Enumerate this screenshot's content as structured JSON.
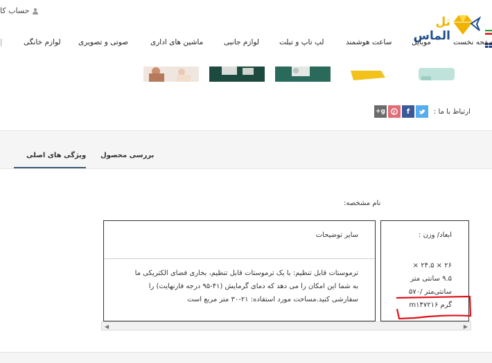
{
  "header": {
    "account_label": "حساب کا",
    "logo": {
      "text_main": "الماس",
      "text_accent": "تل"
    },
    "nav": [
      "صفحه نخست",
      "موبایل",
      "ساعت هوشمند",
      "لپ تاپ و تبلت",
      "لوازم جانبی",
      "ماشین های اداری",
      "صوتی و تصویری",
      "لوازم خانگی"
    ]
  },
  "share": {
    "label": "ارتباط با ما :",
    "icons": [
      "twitter-icon",
      "facebook-icon",
      "pinterest-icon",
      "google-plus-icon"
    ],
    "colors": {
      "twitter": "#55acee",
      "facebook": "#3b5998",
      "pinterest": "#e06c75",
      "googleplus": "#6b6b6b"
    }
  },
  "tabs": {
    "main_features": "ویژگی های اصلی",
    "product_review": "بررسی محصول"
  },
  "specs": {
    "name_label": "نام مشخصه:",
    "dimensions_title": "ابعاد/ وزن :",
    "dimensions_lines": [
      "۲۶ × ۲۴.۵ ×",
      "۹.۵ سانتی متر",
      "سانتی‌متر /۵۷۰",
      "گرم m۱۴۷۲۱۶"
    ],
    "other_title": "سایر توضیحات",
    "other_lines": [
      "ترموستات قابل تنظیم: با یک ترموستات قابل تنظیم، بخاری فضای الکتریکی ما",
      "به شما این امکان را می دهد که دمای گرمایش (۴۱-۹۵ درجه فارنهایت) را",
      "سفارشی کنید.مساحت مورد استفاده: ۲۱-۳۰ متر مربع است"
    ]
  },
  "colors": {
    "accent": "#3b5a78",
    "logo_yellow": "#f0b400",
    "logo_blue": "#1f4e8c",
    "annotation_red": "#e0101a"
  }
}
